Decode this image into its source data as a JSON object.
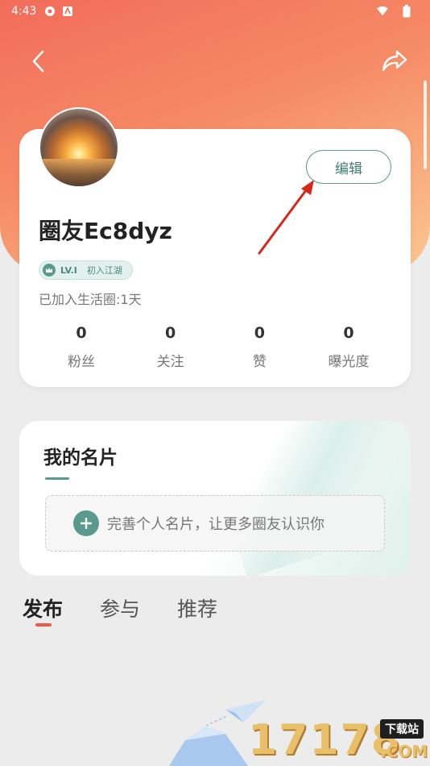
{
  "status_bar": {
    "time": "4:43"
  },
  "profile": {
    "edit_label": "编辑",
    "username": "圈友Ec8dyz",
    "level": {
      "code": "LV.I",
      "title": "初入江湖"
    },
    "joined_text": "已加入生活圈:1天",
    "stats": [
      {
        "value": "0",
        "label": "粉丝"
      },
      {
        "value": "0",
        "label": "关注"
      },
      {
        "value": "0",
        "label": "赞"
      },
      {
        "value": "0",
        "label": "曝光度"
      }
    ]
  },
  "business_card": {
    "title": "我的名片",
    "cta_text": "完善个人名片，让更多圈友认识你"
  },
  "tabs": [
    {
      "label": "发布"
    },
    {
      "label": "参与"
    },
    {
      "label": "推荐"
    }
  ],
  "watermark": {
    "brand": "17178",
    "site": "下载站",
    "suffix": ".COM"
  },
  "colors": {
    "header_gradient_start": "#f26c5a",
    "header_gradient_end": "#fcc792",
    "accent_teal": "#5a9a8e",
    "tab_indicator": "#ec5a42",
    "annotation_arrow": "#d9261c"
  },
  "icons": {
    "back": "chevron-left-icon",
    "share": "share-icon",
    "plus": "plus-icon",
    "level": "crown-icon"
  }
}
